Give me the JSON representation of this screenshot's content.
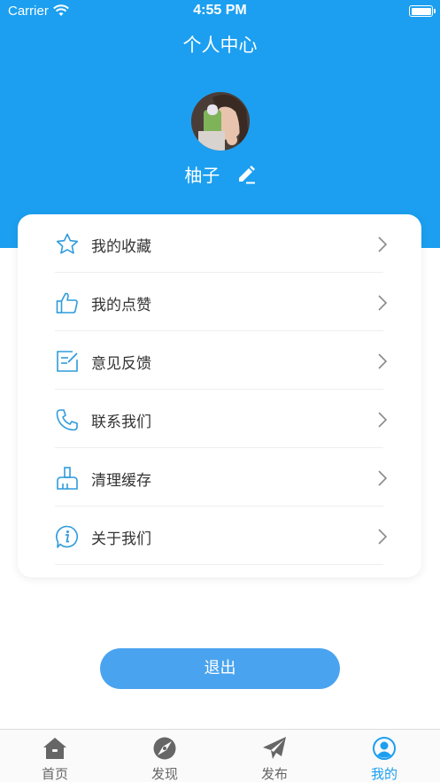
{
  "status_bar": {
    "carrier": "Carrier",
    "time": "4:55 PM"
  },
  "header": {
    "title": "个人中心"
  },
  "profile": {
    "username": "柚子"
  },
  "menu": {
    "items": [
      {
        "label": "我的收藏",
        "icon": "star-icon"
      },
      {
        "label": "我的点赞",
        "icon": "thumbs-up-icon"
      },
      {
        "label": "意见反馈",
        "icon": "feedback-edit-icon"
      },
      {
        "label": "联系我们",
        "icon": "phone-icon"
      },
      {
        "label": "清理缓存",
        "icon": "broom-icon"
      },
      {
        "label": "关于我们",
        "icon": "info-icon"
      }
    ]
  },
  "logout": {
    "label": "退出"
  },
  "tabbar": {
    "tabs": [
      {
        "label": "首页",
        "icon": "home-icon"
      },
      {
        "label": "发现",
        "icon": "discover-icon"
      },
      {
        "label": "发布",
        "icon": "send-icon"
      },
      {
        "label": "我的",
        "icon": "profile-icon"
      }
    ],
    "active_index": 3
  },
  "colors": {
    "primary": "#1c9ff0",
    "button": "#4aa3ef",
    "icon": "#2f9bdc"
  }
}
